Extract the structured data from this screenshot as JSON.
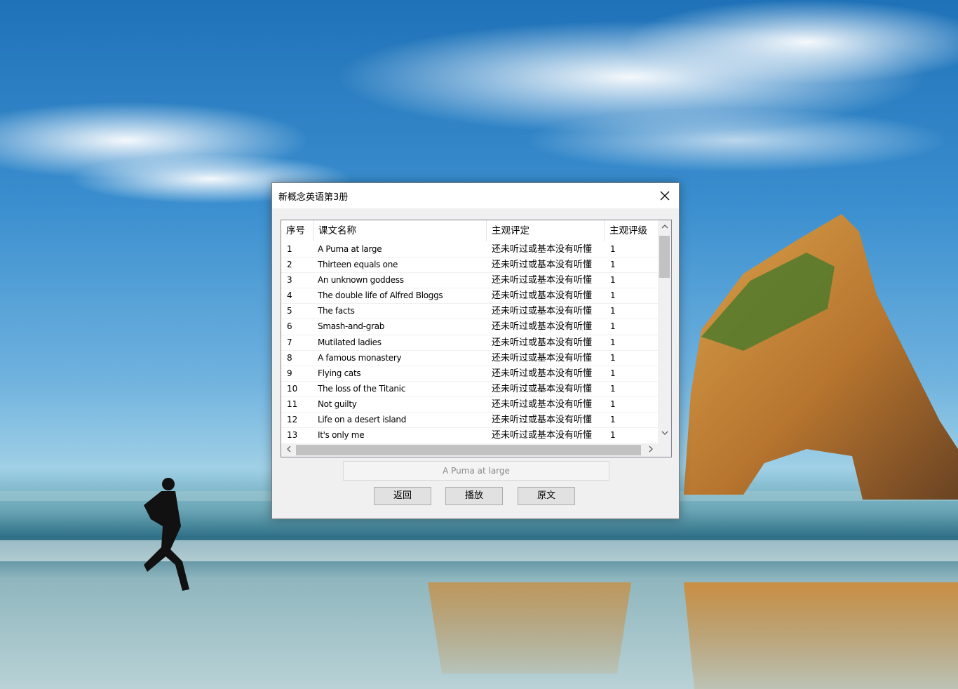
{
  "dialog": {
    "title": "新概念英语第3册",
    "selected_text": "A Puma at large",
    "buttons": {
      "back": "返回",
      "play": "播放",
      "original": "原文"
    }
  },
  "table": {
    "headers": [
      "序号",
      "课文名称",
      "主观评定",
      "主观评级"
    ],
    "rows": [
      [
        "1",
        "A Puma at large",
        "还未听过或基本没有听懂",
        "1"
      ],
      [
        "2",
        "Thirteen equals one",
        "还未听过或基本没有听懂",
        "1"
      ],
      [
        "3",
        "An unknown goddess",
        "还未听过或基本没有听懂",
        "1"
      ],
      [
        "4",
        "The double life of Alfred Bloggs",
        "还未听过或基本没有听懂",
        "1"
      ],
      [
        "5",
        "The facts",
        "还未听过或基本没有听懂",
        "1"
      ],
      [
        "6",
        "Smash-and-grab",
        "还未听过或基本没有听懂",
        "1"
      ],
      [
        "7",
        "Mutilated ladies",
        "还未听过或基本没有听懂",
        "1"
      ],
      [
        "8",
        "A famous monastery",
        "还未听过或基本没有听懂",
        "1"
      ],
      [
        "9",
        "Flying cats",
        "还未听过或基本没有听懂",
        "1"
      ],
      [
        "10",
        "The loss of the Titanic",
        "还未听过或基本没有听懂",
        "1"
      ],
      [
        "11",
        "Not guilty",
        "还未听过或基本没有听懂",
        "1"
      ],
      [
        "12",
        "Life on a desert island",
        "还未听过或基本没有听懂",
        "1"
      ],
      [
        "13",
        "It's only me",
        "还未听过或基本没有听懂",
        "1"
      ]
    ]
  },
  "icons": {
    "close": "close-icon",
    "scroll_up": "chevron-up-icon",
    "scroll_down": "chevron-down-icon",
    "scroll_left": "chevron-left-icon",
    "scroll_right": "chevron-right-icon"
  }
}
